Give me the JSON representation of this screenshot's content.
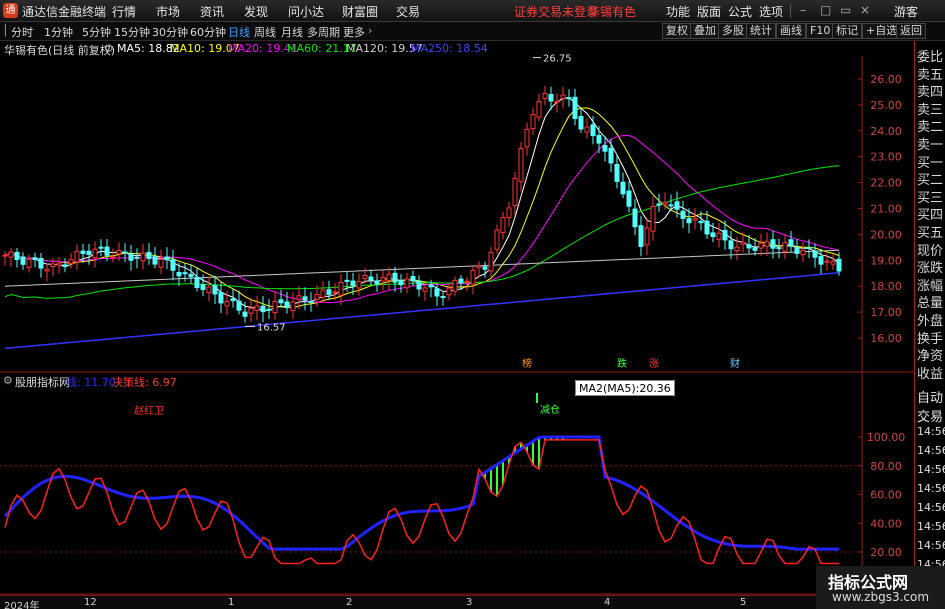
{
  "title_bar": {
    "app_name": "通达信金融终端",
    "menus": [
      "行情",
      "市场",
      "资讯",
      "发现",
      "问小达",
      "财富圈",
      "交易"
    ],
    "notice": "证券交易未登录",
    "stock_name": "华锡有色",
    "right_menus": [
      "功能",
      "版面",
      "公式",
      "选项"
    ],
    "guest": "游客"
  },
  "toolbar": {
    "periods": [
      "分时",
      "1分钟",
      "5分钟",
      "15分钟",
      "30分钟",
      "60分钟",
      "日线",
      "周线",
      "月线",
      "多周期",
      "更多"
    ],
    "active_period": "日线",
    "buttons": [
      "复权",
      "叠加",
      "多股",
      "统计",
      "画线",
      "F10",
      "标记",
      "+自选",
      "返回"
    ]
  },
  "main_legend": {
    "title": "华锡有色(日线 前复权)",
    "ma5": "MA5: 18.82",
    "ma10": "MA10: 19.07",
    "ma20": "MA20: 19.41",
    "ma60": "MA60: 21.17",
    "ma120": "MA120: 19.57",
    "ma250": "MA250: 18.54"
  },
  "price_axis": [
    "26.00",
    "25.00",
    "24.00",
    "23.00",
    "22.00",
    "21.00",
    "20.00",
    "19.00",
    "18.00",
    "17.00",
    "16.00"
  ],
  "annotations": {
    "high": "26.75",
    "low": "16.57",
    "marks": [
      "榜",
      "跌",
      "涨",
      "财"
    ]
  },
  "indicator_legend": {
    "name": "股朋指标网",
    "line1": "线: 11.70",
    "line2": "决策线: 6.97",
    "label_red": "赵红卫",
    "label_buy": "减仓"
  },
  "indicator_axis": [
    "100.00",
    "80.00",
    "60.00",
    "40.00",
    "20.00"
  ],
  "tooltip": "MA2(MA5):20.36",
  "right_panel": {
    "items": [
      "委比",
      "卖五",
      "卖四",
      "卖三",
      "卖二",
      "卖一",
      "买一",
      "买二",
      "买三",
      "买四",
      "买五",
      "现价",
      "涨跌",
      "涨幅",
      "总量",
      "外盘",
      "换手",
      "净资",
      "收益"
    ],
    "bottom_items": [
      "自动",
      "交易",
      "14:56",
      "14:56",
      "14:56",
      "14:56",
      "14:56",
      "14:56",
      "14:56",
      "14:56"
    ]
  },
  "date_axis": [
    "2024年",
    "12",
    "1",
    "2",
    "3",
    "4",
    "5"
  ],
  "watermark": {
    "line1": "指标公式网",
    "line2": "www.zbgs3.com"
  },
  "colors": {
    "up": "#ff3232",
    "down": "#54ffff",
    "ma5": "#ffffff",
    "ma10": "#ffff00",
    "ma20": "#ff00ff",
    "ma60": "#00e600",
    "ma120": "#c8c8c8",
    "ma250": "#3333ff"
  }
}
